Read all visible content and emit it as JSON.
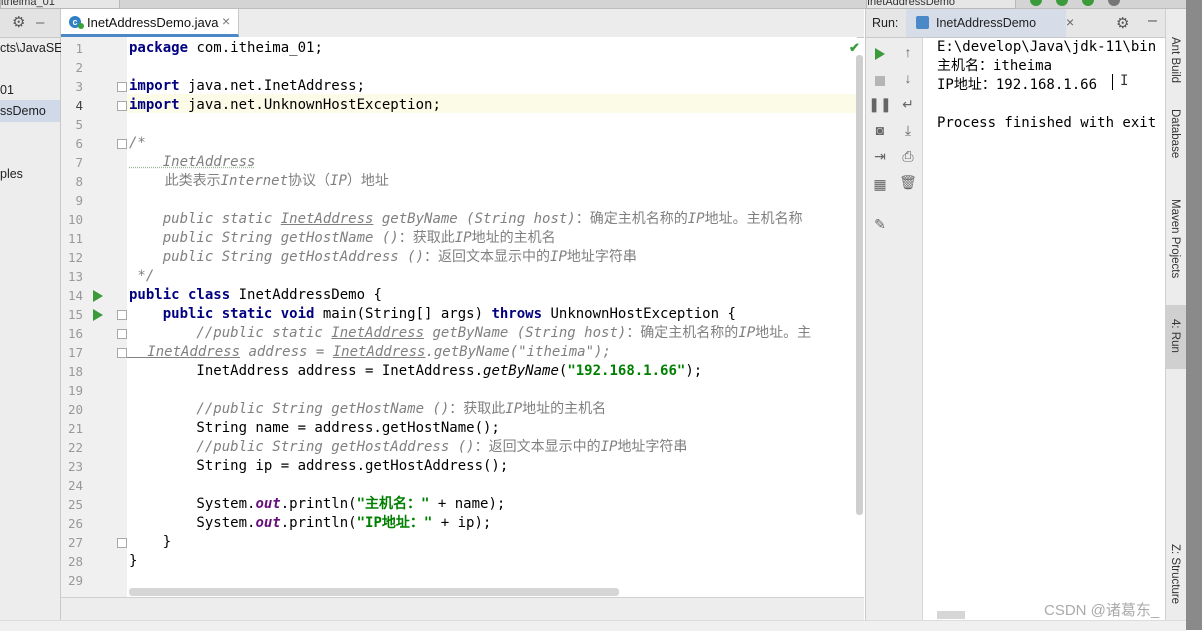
{
  "window": {
    "top_tabs": [
      "itheima_01",
      "InetAddressDemo"
    ]
  },
  "project_panel": {
    "items": [
      "cts\\JavaSE",
      "01",
      "ssDemo",
      "ples"
    ],
    "selected_item": "ssDemo"
  },
  "editor": {
    "tab_label": "InetAddressDemo.java",
    "tab_close": "×",
    "line_numbers": [
      "1",
      "2",
      "3",
      "4",
      "5",
      "6",
      "7",
      "8",
      "9",
      "10",
      "11",
      "12",
      "13",
      "14",
      "15",
      "16",
      "17",
      "18",
      "19",
      "20",
      "21",
      "22",
      "23",
      "24",
      "25",
      "26",
      "27",
      "28",
      "29"
    ],
    "current_line": 4,
    "lines": {
      "l1_kw": "package",
      "l1_rest": " com.itheima_01;",
      "l3_kw": "import",
      "l3_rest": " java.net.InetAddress;",
      "l4_kw": "import",
      "l4_rest": " java.net.UnknownHostException;",
      "l6": "/*",
      "l7": "    InetAddress",
      "l8_a": "        此类表示",
      "l8_b": "Internet",
      "l8_c": "协议（",
      "l8_d": "IP",
      "l8_e": "）地址",
      "l10_a": "    public static ",
      "l10_b": "InetAddress",
      "l10_c": " getByName (String host)",
      "l10_d": "：确定主机名称的",
      "l10_e": "IP",
      "l10_f": "地址。主机名称",
      "l11_a": "    public String getHostName ()",
      "l11_b": "：获取此",
      "l11_c": "IP",
      "l11_d": "地址的主机名",
      "l12_a": "    public String getHostAddress ()",
      "l12_b": "：返回文本显示中的",
      "l12_c": "IP",
      "l12_d": "地址字符串",
      "l13": " */",
      "l14_kw": "public class",
      "l14_rest": " InetAddressDemo {",
      "l15_kw1": "    public static void",
      "l15_mid": " main(String[] args) ",
      "l15_kw2": "throws",
      "l15_rest": " UnknownHostException {",
      "l16_a": "        //public static ",
      "l16_b": "InetAddress",
      "l16_c": " getByName (String host)",
      "l16_d": "：确定主机名称的",
      "l16_e": "IP",
      "l16_f": "地址。主",
      "l17_a": "//",
      "l17_b": "        InetAddress",
      "l17_c": " address = ",
      "l17_d": "InetAddress",
      "l17_e": ".getByName(\"itheima\");",
      "l18_a": "        InetAddress address = InetAddress.",
      "l18_b": "getByName",
      "l18_c": "(",
      "l18_d": "\"192.168.1.66\"",
      "l18_e": ");",
      "l20_a": "        //public String getHostName ()",
      "l20_b": "：获取此",
      "l20_c": "IP",
      "l20_d": "地址的主机名",
      "l21": "        String name = address.getHostName();",
      "l22_a": "        //public String getHostAddress ()",
      "l22_b": "：返回文本显示中的",
      "l22_c": "IP",
      "l22_d": "地址字符串",
      "l23": "        String ip = address.getHostAddress();",
      "l25_a": "        System.",
      "l25_b": "out",
      "l25_c": ".println(",
      "l25_d": "\"主机名：\"",
      "l25_e": " + name);",
      "l26_a": "        System.",
      "l26_b": "out",
      "l26_c": ".println(",
      "l26_d": "\"IP地址：\"",
      "l26_e": " + ip);",
      "l27": "    }",
      "l28": "}"
    }
  },
  "run_panel": {
    "label": "Run:",
    "tab_label": "InetAddressDemo",
    "tab_close": "×",
    "console": [
      "E:\\develop\\Java\\jdk-11\\bin",
      "主机名：itheima",
      "IP地址：192.168.1.66",
      "",
      "Process finished with exit"
    ]
  },
  "right_sidebar": {
    "items": [
      "Ant Build",
      "Database",
      "Maven Projects",
      "4: Run",
      "Z: Structure"
    ]
  },
  "watermark": "CSDN @诸葛东_",
  "colors": {
    "keyword": "#000080",
    "string": "#008000",
    "comment": "#808080",
    "static_field": "#660e7a",
    "current_line": "#fcfbe7",
    "run_green": "#3b9b3b",
    "selection": "#cfd9e8"
  }
}
